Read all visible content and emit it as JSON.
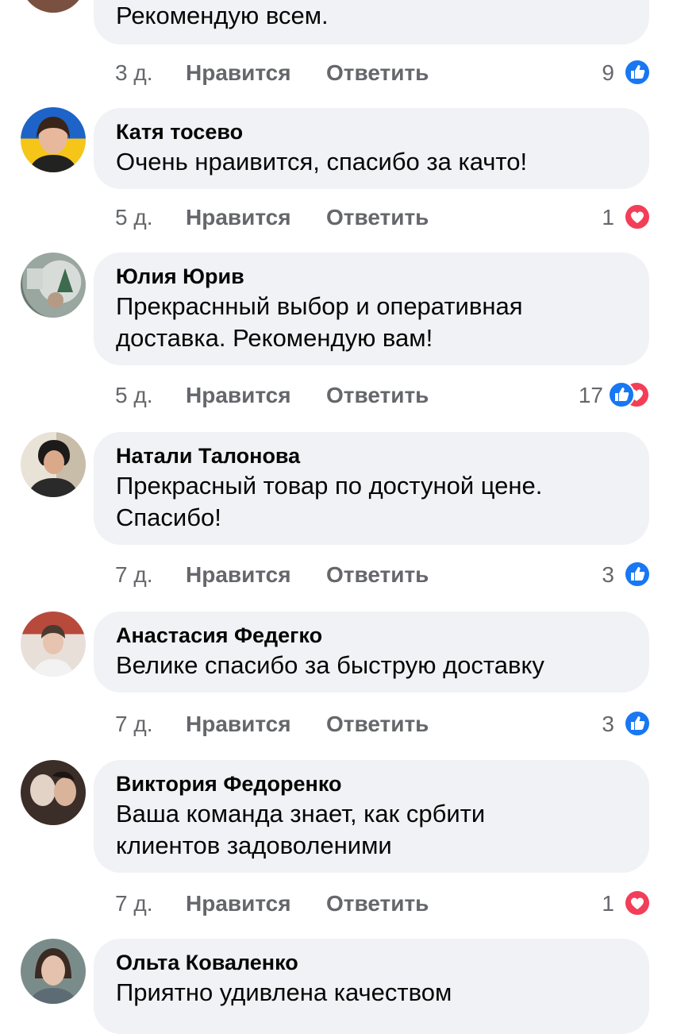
{
  "labels": {
    "like": "Нравится",
    "reply": "Ответить"
  },
  "colors": {
    "bubble": "#f0f2f5",
    "like_blue": "#1877f2",
    "love_red": "#f33e58",
    "meta_gray": "#65676b"
  },
  "first_comment": {
    "text": "Рекомендую всем.",
    "time": "3 д.",
    "reaction_count": "9",
    "reactions": [
      "like-icon"
    ]
  },
  "comments": [
    {
      "author": "Катя тосево",
      "text": "Очень нраивится,  спасибо за качто!",
      "time": "5 д.",
      "reaction_count": "1",
      "reactions": [
        "love-icon"
      ]
    },
    {
      "author": "Юлия Юрив",
      "text": "Прекраснный выбор и оперативная доставка. Рекомендую вам!",
      "time": "5 д.",
      "reaction_count": "17",
      "reactions": [
        "like-icon",
        "love-icon"
      ]
    },
    {
      "author": "Натали Талонова",
      "text": "Прекрасный товар по достуной цене. Спасибо!",
      "time": "7 д.",
      "reaction_count": "3",
      "reactions": [
        "like-icon"
      ]
    },
    {
      "author": "Анастасия Федегко",
      "text": "Велике спасибо за быструю доставку",
      "time": "7 д.",
      "reaction_count": "3",
      "reactions": [
        "like-icon"
      ]
    },
    {
      "author": "Виктория Федоренко",
      "text": "Ваша команда знает, как србити клиентов задоволеними",
      "time": "7 д.",
      "reaction_count": "1",
      "reactions": [
        "love-icon"
      ]
    },
    {
      "author": "Ольта Коваленко",
      "text": "Приятно удивлена качеством",
      "time": "",
      "reaction_count": "",
      "reactions": []
    }
  ]
}
